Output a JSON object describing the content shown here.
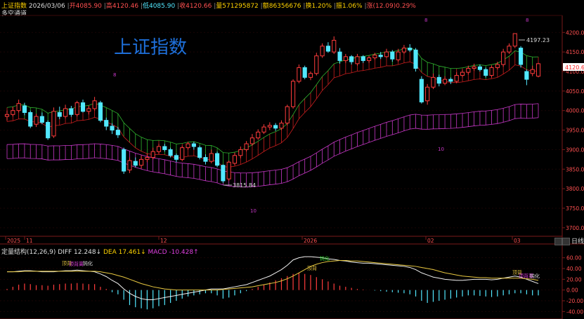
{
  "header": {
    "title": "上证指数",
    "date": "2026/03/06",
    "open": "开4085.90",
    "high": "高4120.46",
    "low": "低4085.90",
    "close": "收4120.66",
    "volume": "量571295872",
    "amount": "额86356676",
    "turnover": "换1.20%",
    "amplitude": "振1.06%",
    "change": "涨(12.09)0.29%",
    "indicator": "多空通道"
  },
  "watermark": "上证指数",
  "price_axis": {
    "ticks": [
      "4200.00",
      "4150.00",
      "4100.00",
      "4050.00",
      "4000.00",
      "3950.00",
      "3900.00",
      "3850.00",
      "3800.00",
      "3750.00",
      "3700.00"
    ],
    "current": "4120.66"
  },
  "macd_axis": {
    "ticks": [
      "60.00",
      "40.00",
      "20.00",
      "0.00",
      "-20.00",
      "-40.00"
    ]
  },
  "time_axis": [
    "2025",
    "11",
    "12",
    "2026",
    "02",
    "03"
  ],
  "toolbar": {
    "period": "日线"
  },
  "annotations": {
    "high_label": "4197.23",
    "low_label": "3815.84",
    "cycle_marks": [
      "8",
      "8",
      "10",
      "8",
      "10"
    ],
    "macd_signals": [
      "顶背",
      "顶背离",
      "钝化",
      "顶背",
      "钝化",
      "顶背离",
      "钝化"
    ]
  },
  "macd_header": {
    "name": "定量结构(12,26,9)",
    "diff": "DIFF 12.248↓",
    "dea": "DEA 17.461↓",
    "macd": "MACD -10.428↑"
  },
  "colors": {
    "up": "#ff3c3c",
    "down": "#52e8ff",
    "channel_red": "#c81e1e",
    "channel_green": "#2fb52f",
    "channel_purple": "#c838c8",
    "watermark": "#1e6fd9",
    "diff_line": "#f0f0f0",
    "dea_line": "#e8c840"
  },
  "chart_data": {
    "type": "candlestick",
    "ylim": [
      3680,
      4240
    ],
    "candles": [
      {
        "o": 3985,
        "c": 3990,
        "h": 4000,
        "l": 3975
      },
      {
        "o": 3990,
        "c": 4000,
        "h": 4010,
        "l": 3985
      },
      {
        "o": 4000,
        "c": 4018,
        "h": 4028,
        "l": 3995
      },
      {
        "o": 4012,
        "c": 3995,
        "h": 4020,
        "l": 3988
      },
      {
        "o": 3995,
        "c": 3960,
        "h": 4000,
        "l": 3955
      },
      {
        "o": 3965,
        "c": 3985,
        "h": 3992,
        "l": 3958
      },
      {
        "o": 3985,
        "c": 3970,
        "h": 3995,
        "l": 3965
      },
      {
        "o": 3970,
        "c": 3930,
        "h": 3975,
        "l": 3925
      },
      {
        "o": 3935,
        "c": 3998,
        "h": 4008,
        "l": 3930
      },
      {
        "o": 3995,
        "c": 3985,
        "h": 4010,
        "l": 3978
      },
      {
        "o": 3985,
        "c": 4005,
        "h": 4015,
        "l": 3980
      },
      {
        "o": 4005,
        "c": 3990,
        "h": 4012,
        "l": 3984
      },
      {
        "o": 3990,
        "c": 4020,
        "h": 4025,
        "l": 3985
      },
      {
        "o": 4020,
        "c": 3998,
        "h": 4028,
        "l": 3995
      },
      {
        "o": 3998,
        "c": 4005,
        "h": 4012,
        "l": 3990
      },
      {
        "o": 4005,
        "c": 4025,
        "h": 4035,
        "l": 4000
      },
      {
        "o": 4020,
        "c": 3975,
        "h": 4025,
        "l": 3970
      },
      {
        "o": 3975,
        "c": 3960,
        "h": 3982,
        "l": 3950
      },
      {
        "o": 3960,
        "c": 3950,
        "h": 3968,
        "l": 3940
      },
      {
        "o": 3950,
        "c": 3938,
        "h": 3958,
        "l": 3930
      },
      {
        "o": 3900,
        "c": 3845,
        "h": 3905,
        "l": 3838
      },
      {
        "o": 3848,
        "c": 3872,
        "h": 3880,
        "l": 3840
      },
      {
        "o": 3870,
        "c": 3860,
        "h": 3880,
        "l": 3855
      },
      {
        "o": 3860,
        "c": 3875,
        "h": 3885,
        "l": 3852
      },
      {
        "o": 3875,
        "c": 3880,
        "h": 3890,
        "l": 3868
      },
      {
        "o": 3880,
        "c": 3895,
        "h": 3905,
        "l": 3875
      },
      {
        "o": 3895,
        "c": 3908,
        "h": 3915,
        "l": 3890
      },
      {
        "o": 3908,
        "c": 3900,
        "h": 3915,
        "l": 3895
      },
      {
        "o": 3900,
        "c": 3885,
        "h": 3905,
        "l": 3880
      },
      {
        "o": 3885,
        "c": 3875,
        "h": 3890,
        "l": 3868
      },
      {
        "o": 3875,
        "c": 3905,
        "h": 3910,
        "l": 3870
      },
      {
        "o": 3905,
        "c": 3915,
        "h": 3920,
        "l": 3900
      },
      {
        "o": 3915,
        "c": 3908,
        "h": 3920,
        "l": 3900
      },
      {
        "o": 3905,
        "c": 3880,
        "h": 3910,
        "l": 3875
      },
      {
        "o": 3880,
        "c": 3870,
        "h": 3888,
        "l": 3862
      },
      {
        "o": 3870,
        "c": 3890,
        "h": 3900,
        "l": 3865
      },
      {
        "o": 3890,
        "c": 3860,
        "h": 3895,
        "l": 3855
      },
      {
        "o": 3860,
        "c": 3820,
        "h": 3862,
        "l": 3815
      },
      {
        "o": 3825,
        "c": 3868,
        "h": 3872,
        "l": 3820
      },
      {
        "o": 3865,
        "c": 3885,
        "h": 3892,
        "l": 3860
      },
      {
        "o": 3885,
        "c": 3900,
        "h": 3908,
        "l": 3878
      },
      {
        "o": 3900,
        "c": 3915,
        "h": 3922,
        "l": 3895
      },
      {
        "o": 3915,
        "c": 3930,
        "h": 3940,
        "l": 3910
      },
      {
        "o": 3930,
        "c": 3945,
        "h": 3952,
        "l": 3925
      },
      {
        "o": 3945,
        "c": 3958,
        "h": 3965,
        "l": 3940
      },
      {
        "o": 3958,
        "c": 3962,
        "h": 3970,
        "l": 3950
      },
      {
        "o": 3962,
        "c": 3955,
        "h": 3968,
        "l": 3948
      },
      {
        "o": 3955,
        "c": 3968,
        "h": 3975,
        "l": 3950
      },
      {
        "o": 3968,
        "c": 4010,
        "h": 4015,
        "l": 3962
      },
      {
        "o": 4010,
        "c": 4075,
        "h": 4080,
        "l": 4005
      },
      {
        "o": 4075,
        "c": 4110,
        "h": 4118,
        "l": 4070
      },
      {
        "o": 4110,
        "c": 4085,
        "h": 4115,
        "l": 4080
      },
      {
        "o": 4085,
        "c": 4095,
        "h": 4100,
        "l": 4078
      },
      {
        "o": 4095,
        "c": 4140,
        "h": 4148,
        "l": 4090
      },
      {
        "o": 4140,
        "c": 4165,
        "h": 4172,
        "l": 4135
      },
      {
        "o": 4165,
        "c": 4152,
        "h": 4175,
        "l": 4148
      },
      {
        "o": 4150,
        "c": 4180,
        "h": 4190,
        "l": 4145
      },
      {
        "o": 4150,
        "c": 4128,
        "h": 4160,
        "l": 4120
      },
      {
        "o": 4128,
        "c": 4138,
        "h": 4145,
        "l": 4122
      },
      {
        "o": 4138,
        "c": 4125,
        "h": 4142,
        "l": 4118
      },
      {
        "o": 4120,
        "c": 4138,
        "h": 4145,
        "l": 4115
      },
      {
        "o": 4138,
        "c": 4128,
        "h": 4142,
        "l": 4122
      },
      {
        "o": 4128,
        "c": 4135,
        "h": 4140,
        "l": 4122
      },
      {
        "o": 4135,
        "c": 4142,
        "h": 4148,
        "l": 4130
      },
      {
        "o": 4142,
        "c": 4138,
        "h": 4150,
        "l": 4132
      },
      {
        "o": 4138,
        "c": 4150,
        "h": 4158,
        "l": 4135
      },
      {
        "o": 4150,
        "c": 4132,
        "h": 4155,
        "l": 4125
      },
      {
        "o": 4130,
        "c": 4150,
        "h": 4158,
        "l": 4125
      },
      {
        "o": 4150,
        "c": 4160,
        "h": 4168,
        "l": 4145
      },
      {
        "o": 4160,
        "c": 4155,
        "h": 4170,
        "l": 4150
      },
      {
        "o": 4155,
        "c": 4108,
        "h": 4160,
        "l": 4100
      },
      {
        "o": 4080,
        "c": 4022,
        "h": 4088,
        "l": 4018
      },
      {
        "o": 4025,
        "c": 4060,
        "h": 4068,
        "l": 4015
      },
      {
        "o": 4060,
        "c": 4085,
        "h": 4095,
        "l": 4055
      },
      {
        "o": 4085,
        "c": 4070,
        "h": 4092,
        "l": 4062
      },
      {
        "o": 4070,
        "c": 4080,
        "h": 4088,
        "l": 4065
      },
      {
        "o": 4080,
        "c": 4075,
        "h": 4085,
        "l": 4068
      },
      {
        "o": 4075,
        "c": 4090,
        "h": 4098,
        "l": 4070
      },
      {
        "o": 4090,
        "c": 4098,
        "h": 4105,
        "l": 4085
      },
      {
        "o": 4098,
        "c": 4108,
        "h": 4115,
        "l": 4092
      },
      {
        "o": 4108,
        "c": 4112,
        "h": 4120,
        "l": 4102
      },
      {
        "o": 4112,
        "c": 4105,
        "h": 4118,
        "l": 4100
      },
      {
        "o": 4105,
        "c": 4090,
        "h": 4110,
        "l": 4085
      },
      {
        "o": 4090,
        "c": 4110,
        "h": 4115,
        "l": 4085
      },
      {
        "o": 4110,
        "c": 4118,
        "h": 4125,
        "l": 4105
      },
      {
        "o": 4118,
        "c": 4150,
        "h": 4158,
        "l": 4112
      },
      {
        "o": 4150,
        "c": 4165,
        "h": 4172,
        "l": 4145
      },
      {
        "o": 4165,
        "c": 4197,
        "h": 4197,
        "l": 4160
      },
      {
        "o": 4160,
        "c": 4118,
        "h": 4165,
        "l": 4110
      },
      {
        "o": 4100,
        "c": 4080,
        "h": 4105,
        "l": 4065
      },
      {
        "o": 4095,
        "c": 4105,
        "h": 4115,
        "l": 4088
      },
      {
        "o": 4088,
        "c": 4120,
        "h": 4122,
        "l": 4085
      }
    ],
    "macd": [
      2,
      6,
      10,
      12,
      11,
      9,
      9,
      8,
      10,
      11,
      12,
      12,
      13,
      12,
      11,
      11,
      6,
      2,
      -4,
      -8,
      -18,
      -28,
      -32,
      -34,
      -36,
      -34,
      -30,
      -28,
      -24,
      -20,
      -16,
      -12,
      -10,
      -8,
      -6,
      -6,
      -10,
      -16,
      -14,
      -10,
      -6,
      -2,
      2,
      6,
      10,
      14,
      18,
      22,
      26,
      30,
      32,
      30,
      28,
      24,
      20,
      16,
      12,
      8,
      6,
      4,
      2,
      1,
      0,
      -1,
      -2,
      -3,
      -4,
      -5,
      -6,
      -8,
      -12,
      -20,
      -24,
      -22,
      -20,
      -18,
      -16,
      -14,
      -12,
      -10,
      -10,
      -11,
      -12,
      -13,
      -12,
      -10,
      -8,
      -6,
      -6,
      -8,
      -10,
      -10
    ],
    "diff": [
      34,
      34,
      35,
      36,
      36,
      35,
      34,
      34,
      34,
      35,
      36,
      36,
      37,
      36,
      35,
      34,
      30,
      25,
      18,
      12,
      2,
      -6,
      -12,
      -16,
      -18,
      -18,
      -16,
      -14,
      -12,
      -10,
      -8,
      -6,
      -4,
      -2,
      0,
      2,
      2,
      2,
      4,
      6,
      8,
      10,
      14,
      18,
      22,
      26,
      32,
      38,
      46,
      56,
      60,
      62,
      62,
      61,
      60,
      58,
      57,
      55,
      54,
      52,
      51,
      50,
      50,
      49,
      48,
      47,
      46,
      45,
      44,
      42,
      38,
      32,
      28,
      24,
      22,
      20,
      19,
      18,
      18,
      19,
      20,
      20,
      20,
      19,
      20,
      22,
      24,
      26,
      24,
      20,
      16,
      12
    ],
    "dea": [
      34,
      34,
      34,
      35,
      35,
      35,
      35,
      35,
      35,
      35,
      35,
      35,
      35,
      35,
      35,
      35,
      34,
      32,
      30,
      27,
      24,
      20,
      16,
      12,
      9,
      6,
      4,
      2,
      1,
      0,
      0,
      0,
      0,
      0,
      0,
      0,
      0,
      1,
      2,
      3,
      4,
      5,
      6,
      8,
      10,
      12,
      14,
      17,
      21,
      26,
      32,
      38,
      44,
      48,
      51,
      53,
      54,
      55,
      55,
      54,
      54,
      53,
      52,
      51,
      50,
      49,
      48,
      47,
      46,
      45,
      44,
      42,
      40,
      38,
      35,
      32,
      30,
      28,
      26,
      25,
      24,
      23,
      23,
      22,
      22,
      22,
      22,
      22,
      22,
      21,
      20,
      18
    ]
  }
}
